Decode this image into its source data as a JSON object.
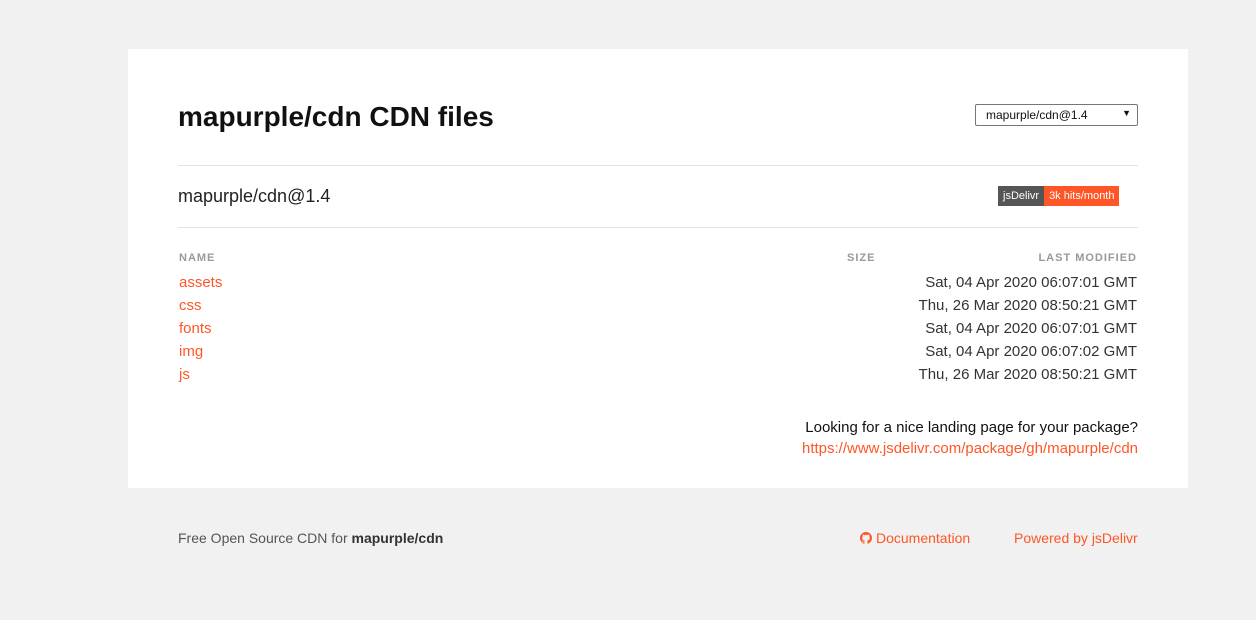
{
  "header": {
    "title": "mapurple/cdn CDN files",
    "version_selected": "mapurple/cdn@1.4"
  },
  "package": {
    "subtitle": "mapurple/cdn@1.4",
    "badge_left": "jsDelivr",
    "badge_right": "3k hits/month"
  },
  "table": {
    "columns": [
      "NAME",
      "SIZE",
      "LAST MODIFIED"
    ],
    "rows": [
      {
        "name": "assets",
        "modified": "Sat, 04 Apr 2020 06:07:01 GMT"
      },
      {
        "name": "css",
        "modified": "Thu, 26 Mar 2020 08:50:21 GMT"
      },
      {
        "name": "fonts",
        "modified": "Sat, 04 Apr 2020 06:07:01 GMT"
      },
      {
        "name": "img",
        "modified": "Sat, 04 Apr 2020 06:07:02 GMT"
      },
      {
        "name": "js",
        "modified": "Thu, 26 Mar 2020 08:50:21 GMT"
      }
    ]
  },
  "landing": {
    "question": "Looking for a nice landing page for your package?",
    "link": "https://www.jsdelivr.com/package/gh/mapurple/cdn"
  },
  "footer": {
    "prefix": "Free Open Source CDN for ",
    "package": "mapurple/cdn",
    "documentation": "Documentation",
    "powered": "Powered by jsDelivr"
  },
  "colors": {
    "accent": "#ff5627",
    "badge_dark": "#555555",
    "background": "#f1f1f1"
  },
  "icons": {
    "documentation": "github-icon",
    "select": "dropdown-arrow-icon"
  }
}
